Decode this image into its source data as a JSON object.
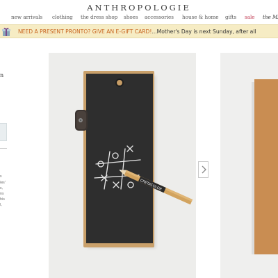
{
  "brand": {
    "name": "ANTHROPOLOGIE"
  },
  "nav": [
    {
      "label": "new arrivals"
    },
    {
      "label": "clothing"
    },
    {
      "label": "the dress shop"
    },
    {
      "label": "shoes"
    },
    {
      "label": "accessories"
    },
    {
      "label": "house & home"
    },
    {
      "label": "gifts"
    },
    {
      "label": "sale"
    },
    {
      "label": "the MA"
    }
  ],
  "promo": {
    "icon": "gift-box-icon",
    "highlight": "NEED A PRESENT PRONTO? GIVE AN E-GIFT CARD!",
    "text": "...Mother's Day is next Sunday, after all"
  },
  "sidebar": {
    "title_fragment": "n",
    "desc_fragments": [
      "s",
      "ies'",
      "s,",
      "ns",
      "his",
      "l,"
    ]
  },
  "product_image": {
    "icons": [
      "tic-tac-toe-marks",
      "pencil",
      "leather-clip-icon"
    ],
    "pencil_brand": "CRETACOLOR"
  },
  "carousel": {
    "next_icon": "chevron-right-icon"
  },
  "colors": {
    "accent_sale": "#c03a52",
    "promo_bg": "#f6ecc4",
    "promo_highlight": "#c8641e",
    "board": "#2e2e2e",
    "wood": "#c98d52"
  }
}
